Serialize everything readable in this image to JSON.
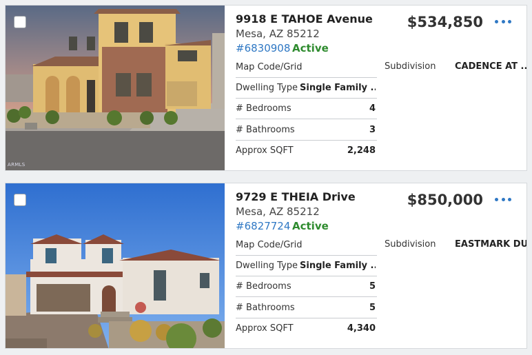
{
  "listings": [
    {
      "street": "9918 E TAHOE Avenue",
      "city": "Mesa, AZ 85212",
      "mls_number": "#6830908",
      "status": "Active",
      "price": "$534,850",
      "watermark": "ARMLS",
      "subdivision_label": "Subdivision",
      "subdivision_value": "CADENCE AT ...",
      "details": [
        {
          "label": "Map Code/Grid",
          "value": ""
        },
        {
          "label": "Dwelling Type",
          "value": "Single Family ..."
        },
        {
          "label": "# Bedrooms",
          "value": "4"
        },
        {
          "label": "# Bathrooms",
          "value": "3"
        },
        {
          "label": "Approx SQFT",
          "value": "2,248"
        }
      ]
    },
    {
      "street": "9729 E THEIA Drive",
      "city": "Mesa, AZ 85212",
      "mls_number": "#6827724",
      "status": "Active",
      "price": "$850,000",
      "watermark": "",
      "subdivision_label": "Subdivision",
      "subdivision_value": "EASTMARK DU...",
      "details": [
        {
          "label": "Map Code/Grid",
          "value": ""
        },
        {
          "label": "Dwelling Type",
          "value": "Single Family ..."
        },
        {
          "label": "# Bedrooms",
          "value": "5"
        },
        {
          "label": "# Bathrooms",
          "value": "5"
        },
        {
          "label": "Approx SQFT",
          "value": "4,340"
        }
      ]
    }
  ],
  "colors": {
    "mls_link": "#2f78c4",
    "status_active": "#2e8b2e",
    "more_menu": "#2f78c4"
  },
  "icons": {
    "more": "more-horizontal-icon",
    "checkbox": "checkbox-icon"
  }
}
